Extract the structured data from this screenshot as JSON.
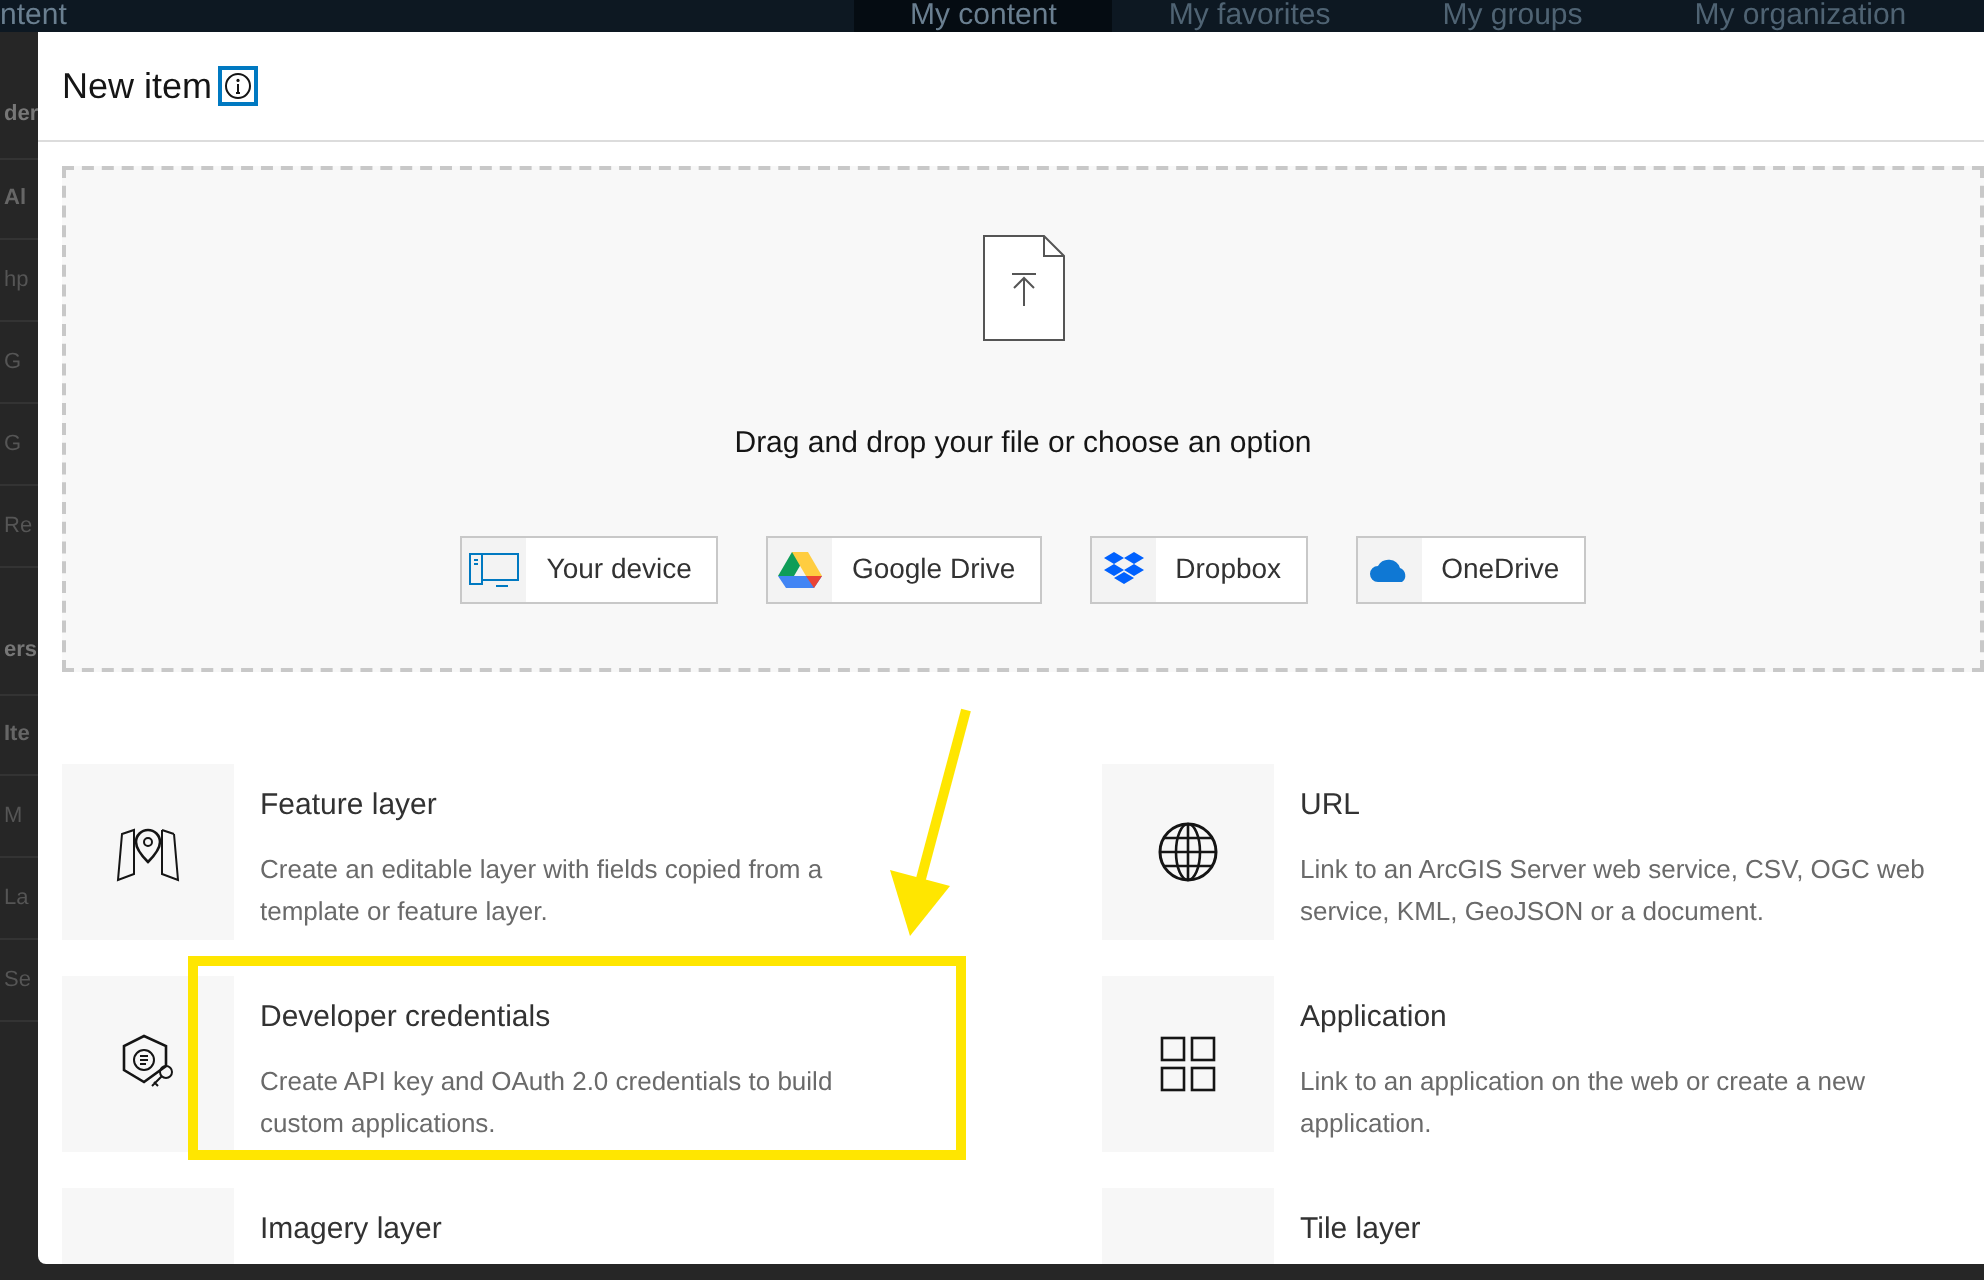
{
  "background_page": {
    "title_fragment": "ntent",
    "tabs": [
      {
        "label": "My content",
        "selected": true
      },
      {
        "label": "My favorites",
        "selected": false
      },
      {
        "label": "My groups",
        "selected": false
      },
      {
        "label": "My organization",
        "selected": false
      }
    ],
    "side_fragments": [
      {
        "text": "der",
        "kind": "heading"
      },
      {
        "text": "Al",
        "kind": "header"
      },
      {
        "text": "hp",
        "kind": "row"
      },
      {
        "text": "G",
        "kind": "row"
      },
      {
        "text": "G",
        "kind": "row"
      },
      {
        "text": "Re",
        "kind": "row"
      },
      {
        "text": "ers",
        "kind": "heading"
      },
      {
        "text": "Ite",
        "kind": "header"
      },
      {
        "text": "M",
        "kind": "row"
      },
      {
        "text": "La",
        "kind": "row"
      },
      {
        "text": "Se",
        "kind": "row"
      }
    ]
  },
  "dialog": {
    "title": "New item",
    "dropzone": {
      "prompt": "Drag and drop your file or choose an option",
      "sources": [
        {
          "label": "Your device",
          "kind": "device"
        },
        {
          "label": "Google Drive",
          "kind": "gdrive"
        },
        {
          "label": "Dropbox",
          "kind": "dropbox"
        },
        {
          "label": "OneDrive",
          "kind": "onedrive"
        }
      ]
    },
    "item_types": [
      {
        "title": "Feature layer",
        "description": "Create an editable layer with fields copied from a template or feature layer.",
        "kind": "map",
        "highlighted": false
      },
      {
        "title": "URL",
        "description": "Link to an ArcGIS Server web service, CSV, OGC web service, KML, GeoJSON or a document.",
        "kind": "globe",
        "highlighted": false
      },
      {
        "title": "Developer credentials",
        "description": "Create API key and OAuth 2.0 credentials to build custom applications.",
        "kind": "key",
        "highlighted": true
      },
      {
        "title": "Application",
        "description": "Link to an application on the web or create a new application.",
        "kind": "grid",
        "highlighted": false
      },
      {
        "title": "Imagery layer",
        "kind": "none",
        "highlighted": false
      },
      {
        "title": "Tile layer",
        "kind": "none",
        "highlighted": false
      }
    ]
  }
}
